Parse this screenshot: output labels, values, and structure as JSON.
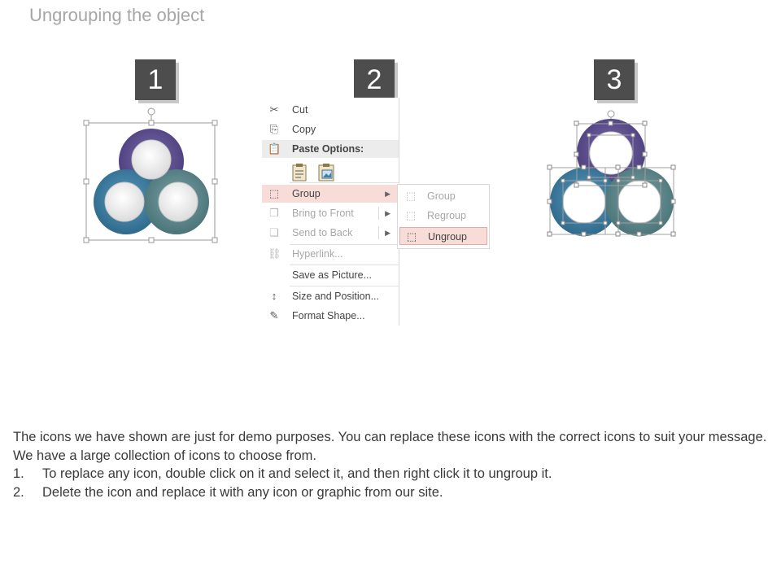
{
  "title": "Ungrouping the object",
  "steps": [
    "1",
    "2",
    "3"
  ],
  "menu": {
    "cut": "Cut",
    "copy": "Copy",
    "paste_options": "Paste Options:",
    "group": "Group",
    "bring_to_front": "Bring to Front",
    "send_to_back": "Send to Back",
    "hyperlink": "Hyperlink...",
    "save_as_picture": "Save as Picture...",
    "size_and_position": "Size and Position...",
    "format_shape": "Format Shape..."
  },
  "submenu": {
    "group": "Group",
    "regroup": "Regroup",
    "ungroup": "Ungroup"
  },
  "colors": {
    "purple": "#5e4f8f",
    "blue": "#3f7fa3",
    "teal": "#5f8a8f",
    "highlight": "#f8dcd8"
  },
  "body": {
    "intro": "The icons we have shown are just for demo purposes. You can replace these icons with the correct icons to suit your message. We have a large collection of icons to choose from.",
    "item1_num": "1.",
    "item1": "To replace any icon, double click on it and select it, and then right click it to ungroup it.",
    "item2_num": "2.",
    "item2": "Delete the icon and replace it with any icon or graphic from our site."
  }
}
